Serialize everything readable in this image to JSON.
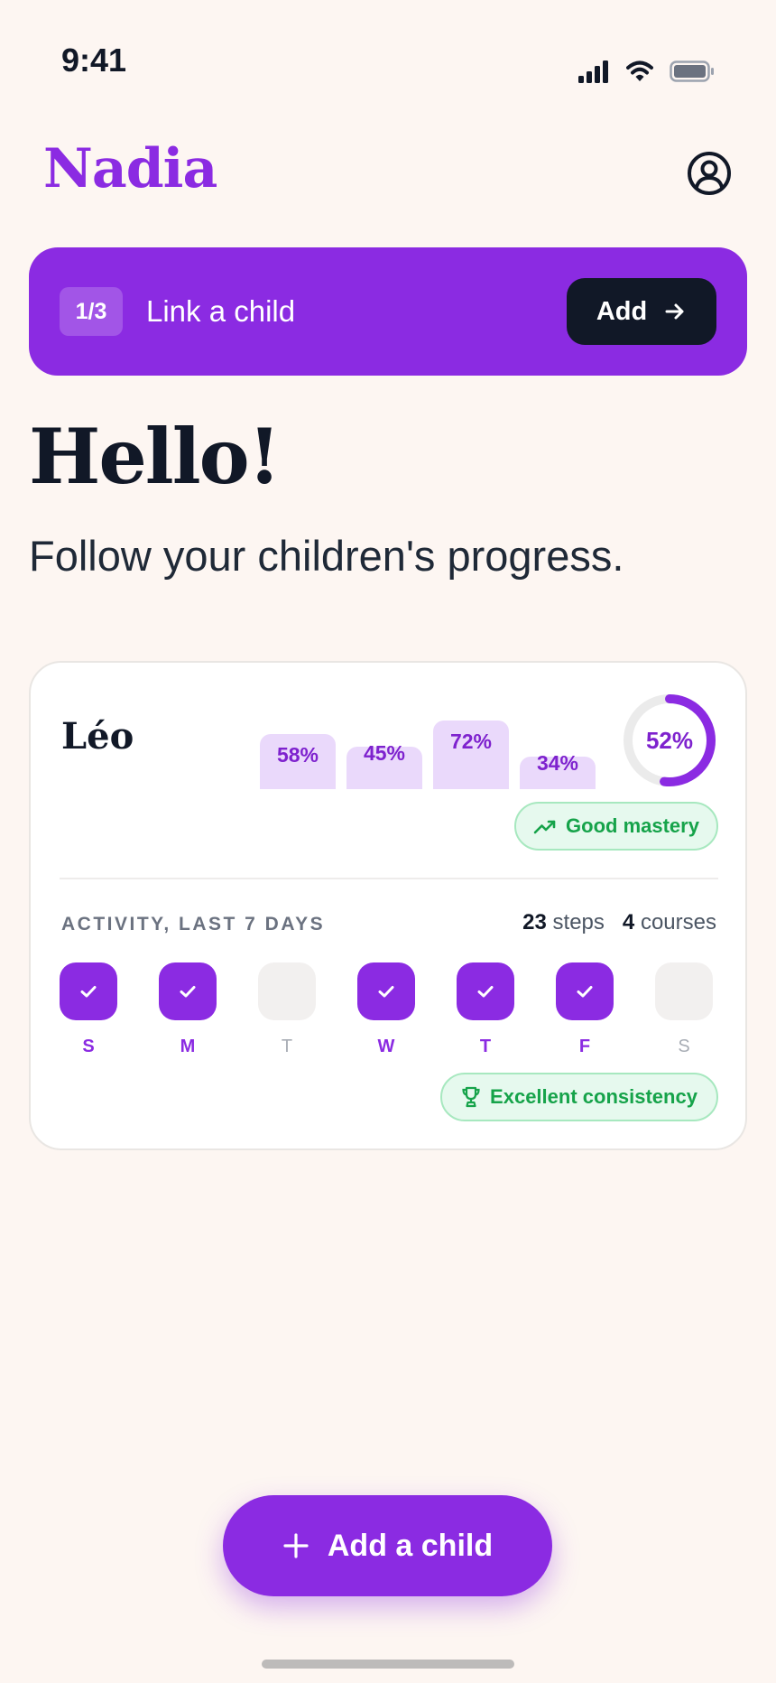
{
  "status_bar": {
    "time": "9:41"
  },
  "header": {
    "brand": "Nadia"
  },
  "banner": {
    "step": "1/3",
    "label": "Link a child",
    "action_label": "Add"
  },
  "greeting": {
    "title": "Hello!",
    "subtitle": "Follow your children's progress."
  },
  "child_card": {
    "name": "Léo",
    "mastery": {
      "bars": [
        {
          "label": "58%",
          "value": 0.58
        },
        {
          "label": "45%",
          "value": 0.45
        },
        {
          "label": "72%",
          "value": 0.72
        },
        {
          "label": "34%",
          "value": 0.34
        }
      ],
      "overall_label": "52%",
      "overall_value": 0.52,
      "badge": "Good mastery"
    },
    "activity": {
      "title": "ACTIVITY, LAST 7 DAYS",
      "steps_count": "23",
      "steps_label": "steps",
      "courses_count": "4",
      "courses_label": "courses",
      "days": [
        {
          "letter": "S",
          "done": true
        },
        {
          "letter": "M",
          "done": true
        },
        {
          "letter": "T",
          "done": false
        },
        {
          "letter": "W",
          "done": true
        },
        {
          "letter": "T",
          "done": true
        },
        {
          "letter": "F",
          "done": true
        },
        {
          "letter": "S",
          "done": false
        }
      ],
      "badge": "Excellent consistency"
    }
  },
  "fab": {
    "label": "Add a child"
  },
  "colors": {
    "accent": "#8b2be2",
    "accent_light": "#ead9fb",
    "success": "#16a34a",
    "background": "#fdf6f2"
  }
}
